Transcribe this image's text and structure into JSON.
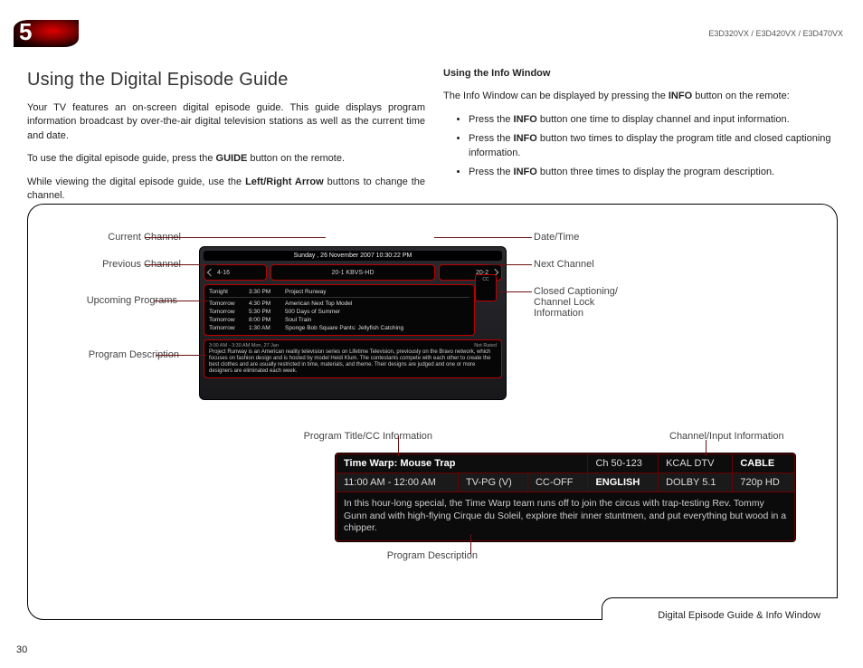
{
  "header": {
    "chapter_number": "5",
    "models": "E3D320VX / E3D420VX / E3D470VX"
  },
  "left_column": {
    "title": "Using the Digital Episode Guide",
    "para1": "Your TV features an on-screen digital episode guide. This guide displays program information broadcast by over-the-air digital television stations as well as the current time and date.",
    "para2_pre": "To use the digital episode guide, press the ",
    "para2_b": "GUIDE",
    "para2_post": " button on the remote.",
    "para3_pre": "While viewing the digital episode guide, use the ",
    "para3_b": "Left/Right Arrow",
    "para3_post": " buttons to change the channel."
  },
  "right_column": {
    "subhead": "Using the Info Window",
    "intro_pre": "The Info Window can be displayed by pressing the ",
    "intro_b": "INFO",
    "intro_post": " button on the remote:",
    "bullets": [
      {
        "pre": "Press the ",
        "b": "INFO",
        "post": " button one time to display channel and input information."
      },
      {
        "pre": "Press the ",
        "b": "INFO",
        "post": " button two times to display the program title and closed captioning information."
      },
      {
        "pre": "Press the ",
        "b": "INFO",
        "post": " button three times to display the program description."
      }
    ]
  },
  "callouts_guide": {
    "current_channel": "Current Channel",
    "previous_channel": "Previous Channel",
    "upcoming_programs": "Upcoming Programs",
    "program_description": "Program Description",
    "date_time": "Date/Time",
    "next_channel": "Next Channel",
    "cc_lock": "Closed Captioning/\nChannel Lock\nInformation"
  },
  "callouts_info": {
    "title_cc": "Program Title/CC Information",
    "channel_input": "Channel/Input Information",
    "program_description": "Program Description"
  },
  "guide_mock": {
    "date_bar": "Sunday , 26 November 2007 10:30:22 PM",
    "prev_ch": "4-16",
    "curr_ch": "20-1 KBVS-HD",
    "next_ch": "20-2",
    "current_row": {
      "day": "Tonight",
      "time": "3:30 PM",
      "title": "Project Runway"
    },
    "rows": [
      {
        "day": "Tomorrow",
        "time": "4:30 PM",
        "title": "American Next Top Model"
      },
      {
        "day": "Tomorrow",
        "time": "5:30 PM",
        "title": "500 Days of Summer"
      },
      {
        "day": "Tomorrow",
        "time": "8:00 PM",
        "title": "Soul Train"
      },
      {
        "day": "Tomorrow",
        "time": "1:30 AM",
        "title": "Sponge Bob Square Pants: Jellyfish Catching"
      }
    ],
    "cc_label": "CC",
    "desc_head_left": "3:00 AM - 3:30 AM Mon, 27 Jan",
    "desc_head_right": "Not Rated",
    "desc_body": "Project Runway is an American reality television series on Lifetime Television, previously on the Bravo network, which focuses on fashion design and is hosted by model Heidi Klum. The contestants compete with each other to create the best clothes and are usually restricted in time, materials, and theme. Their designs are judged and one or more designers are eliminated each week."
  },
  "info_mock": {
    "title": "Time Warp: Mouse Trap",
    "channel": "Ch 50-123",
    "station": "KCAL DTV",
    "source": "CABLE",
    "time": "11:00 AM - 12:00 AM",
    "rating": "TV-PG (V)",
    "cc": "CC-OFF",
    "lang": "ENGLISH",
    "audio": "DOLBY 5.1",
    "res": "720p HD",
    "desc": "In this hour-long special, the Time Warp team runs off to join the circus with trap-testing Rev. Tommy Gunn and with high-flying Cirque du Soleil, explore their inner stuntmen, and put everything but wood in a chipper."
  },
  "footer": {
    "frame_caption": "Digital Episode Guide & Info Window",
    "page_number": "30"
  }
}
